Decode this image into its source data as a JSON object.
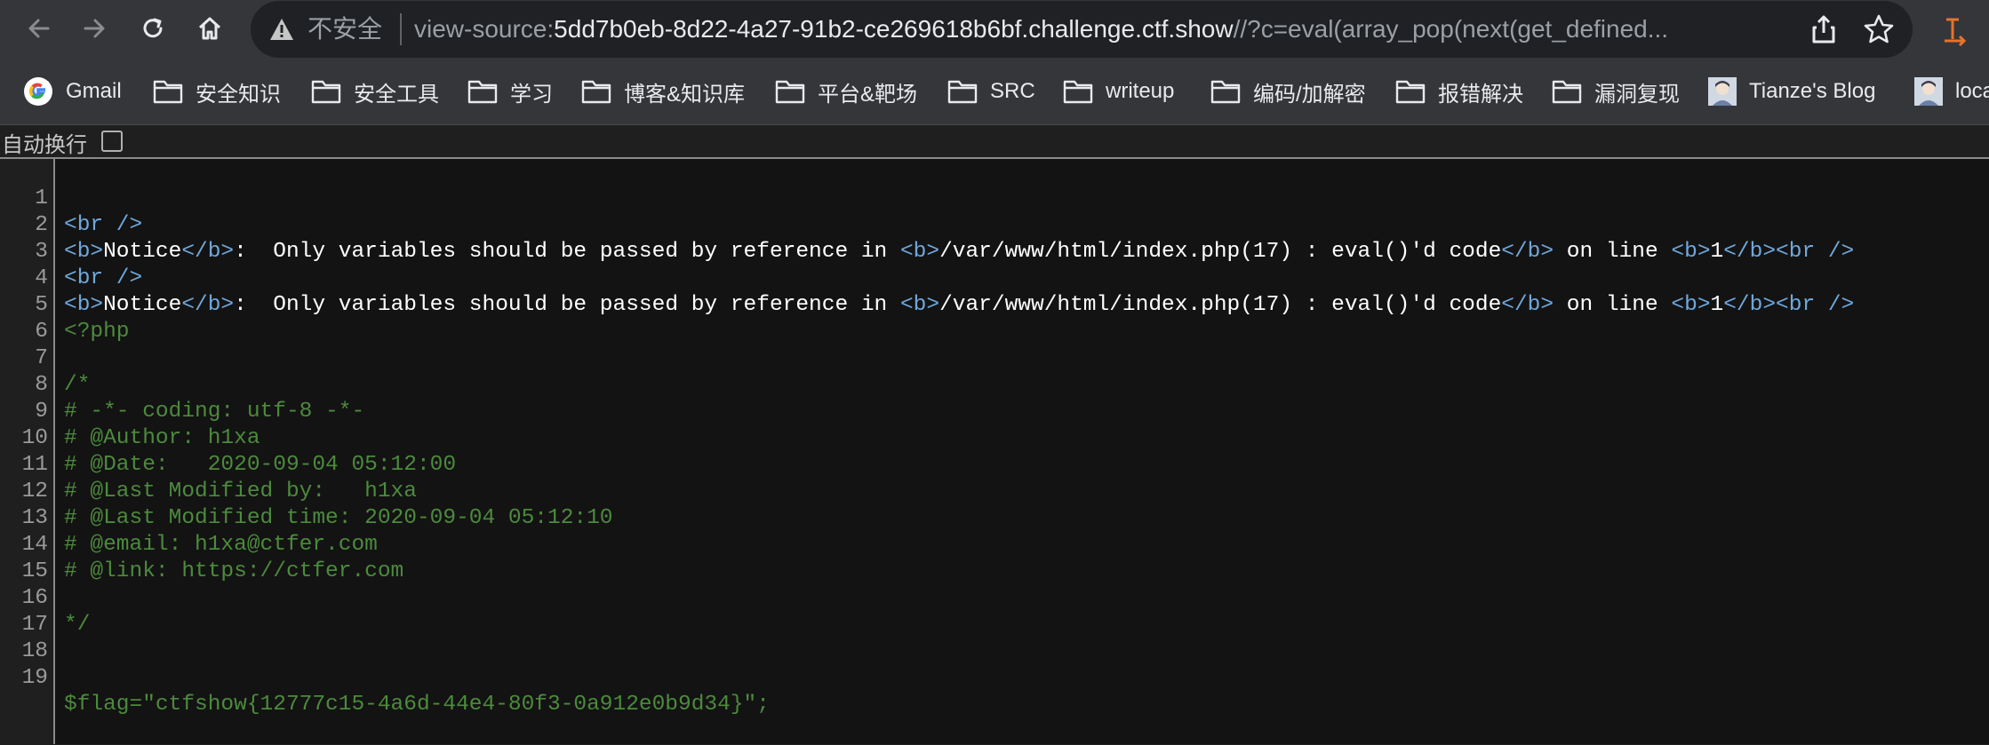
{
  "toolbar": {
    "security_label": "不安全",
    "url_scheme": "view-source:",
    "url_host": "5dd7b0eb-8d22-4a27-91b2-ce269618b6bf.challenge.ctf.show",
    "url_path": "//?c=eval(array_pop(next(get_defined..."
  },
  "bookmarks": [
    {
      "label": "Gmail",
      "icon": "google-icon"
    },
    {
      "label": "安全知识",
      "icon": "folder-icon"
    },
    {
      "label": "安全工具",
      "icon": "folder-icon"
    },
    {
      "label": "学习",
      "icon": "folder-icon"
    },
    {
      "label": "博客&知识库",
      "icon": "folder-icon"
    },
    {
      "label": "平台&靶场",
      "icon": "folder-icon"
    },
    {
      "label": "SRC",
      "icon": "folder-icon"
    },
    {
      "label": "writeup",
      "icon": "folder-icon"
    },
    {
      "label": "编码/加解密",
      "icon": "folder-icon"
    },
    {
      "label": "报错解决",
      "icon": "folder-icon"
    },
    {
      "label": "漏洞复现",
      "icon": "folder-icon"
    },
    {
      "label": "Tianze's Blog",
      "icon": "avatar-icon"
    },
    {
      "label": "loca",
      "icon": "avatar-icon"
    }
  ],
  "wrap": {
    "label": "自动换行"
  },
  "source": {
    "lines": [
      {
        "num": "1"
      },
      {
        "num": "2"
      },
      {
        "num": "3"
      },
      {
        "num": "4"
      },
      {
        "num": "5"
      },
      {
        "num": "6"
      },
      {
        "num": "7"
      },
      {
        "num": "8"
      },
      {
        "num": "9"
      },
      {
        "num": "10"
      },
      {
        "num": "11"
      },
      {
        "num": "12"
      },
      {
        "num": "13"
      },
      {
        "num": "14"
      },
      {
        "num": "15"
      },
      {
        "num": "16"
      },
      {
        "num": "17"
      },
      {
        "num": "18"
      },
      {
        "num": "19"
      }
    ],
    "br_tag": "<br />",
    "b_open": "<b>",
    "b_close": "</b>",
    "notice_word": "Notice",
    "notice_msg": ":  Only variables should be passed by reference in ",
    "notice_file": "/var/www/html/index.php(17) : eval()'d code",
    "on_line": " on line ",
    "line_no": "1",
    "php_open": "<?php",
    "comment_open": "/*",
    "comment_lines": [
      "# -*- coding: utf-8 -*-",
      "# @Author: h1xa",
      "# @Date:   2020-09-04 05:12:00",
      "# @Last Modified by:   h1xa",
      "# @Last Modified time: 2020-09-04 05:12:10",
      "# @email: h1xa@ctfer.com",
      "# @link: https://ctfer.com"
    ],
    "comment_close": "*/",
    "flag_line": "$flag=\"ctfshow{12777c15-4a6d-44e4-80f3-0a912e0b9d34}\";"
  }
}
